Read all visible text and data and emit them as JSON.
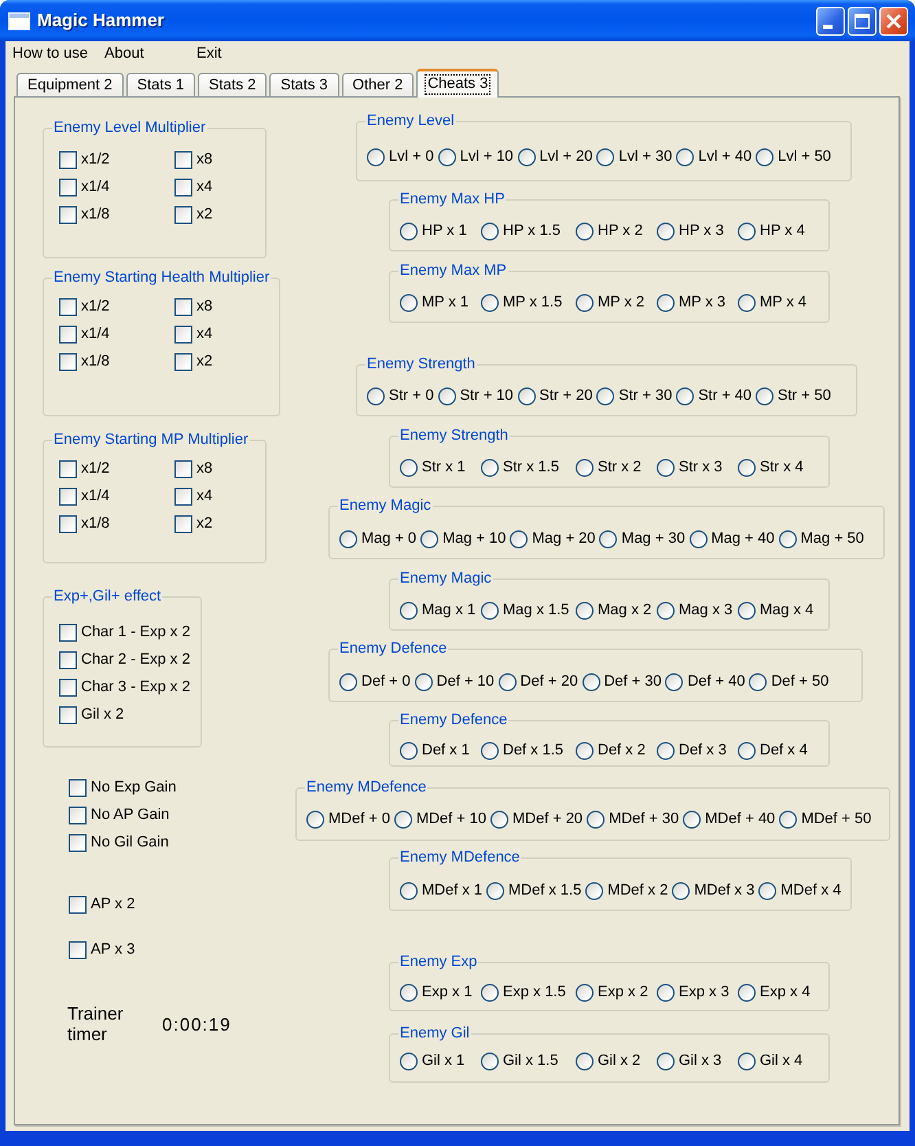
{
  "window": {
    "title": "Magic Hammer"
  },
  "menu": [
    "How to use",
    "About",
    "Exit"
  ],
  "tabs": [
    {
      "label": "Equipment 2",
      "selected": false
    },
    {
      "label": "Stats 1",
      "selected": false
    },
    {
      "label": "Stats 2",
      "selected": false
    },
    {
      "label": "Stats 3",
      "selected": false
    },
    {
      "label": "Other 2",
      "selected": false
    },
    {
      "label": "Cheats 3",
      "selected": true
    }
  ],
  "checkbox_groups": [
    {
      "title": "Enemy Level Multiplier",
      "options": [
        {
          "label": "x1/2",
          "checked": false
        },
        {
          "label": "x8",
          "checked": false
        },
        {
          "label": "x1/4",
          "checked": false
        },
        {
          "label": "x4",
          "checked": false
        },
        {
          "label": "x1/8",
          "checked": false
        },
        {
          "label": "x2",
          "checked": false
        }
      ]
    },
    {
      "title": "Enemy Starting Health Multiplier",
      "options": [
        {
          "label": "x1/2",
          "checked": false
        },
        {
          "label": "x8",
          "checked": false
        },
        {
          "label": "x1/4",
          "checked": false
        },
        {
          "label": "x4",
          "checked": false
        },
        {
          "label": "x1/8",
          "checked": false
        },
        {
          "label": "x2",
          "checked": false
        }
      ]
    },
    {
      "title": "Enemy Starting MP Multiplier",
      "options": [
        {
          "label": "x1/2",
          "checked": false
        },
        {
          "label": "x8",
          "checked": false
        },
        {
          "label": "x1/4",
          "checked": false
        },
        {
          "label": "x4",
          "checked": false
        },
        {
          "label": "x1/8",
          "checked": false
        },
        {
          "label": "x2",
          "checked": false
        }
      ]
    },
    {
      "title": "Exp+,Gil+ effect",
      "options": [
        {
          "label": "Char 1 - Exp x 2",
          "checked": false
        },
        {
          "label": "Char 2 - Exp x 2",
          "checked": false
        },
        {
          "label": "Char 3 - Exp x 2",
          "checked": false
        },
        {
          "label": "Gil x 2",
          "checked": false
        }
      ]
    }
  ],
  "toggles": [
    {
      "label": "No Exp Gain",
      "checked": false
    },
    {
      "label": "No AP Gain",
      "checked": false
    },
    {
      "label": "No Gil Gain",
      "checked": false
    },
    {
      "label": "AP x 2",
      "checked": false
    },
    {
      "label": "AP x 3",
      "checked": false
    }
  ],
  "trainer_timer": {
    "label": "Trainer timer",
    "value": "0:00:19"
  },
  "radio_groups": [
    {
      "title": "Enemy Level",
      "options": [
        {
          "label": "Lvl + 0",
          "selected": false
        },
        {
          "label": "Lvl + 10",
          "selected": false
        },
        {
          "label": "Lvl + 20",
          "selected": false
        },
        {
          "label": "Lvl + 30",
          "selected": false
        },
        {
          "label": "Lvl + 40",
          "selected": false
        },
        {
          "label": "Lvl + 50",
          "selected": false
        }
      ]
    },
    {
      "title": "Enemy Max HP",
      "options": [
        {
          "label": "HP x 1",
          "selected": false
        },
        {
          "label": "HP x 1.5",
          "selected": false
        },
        {
          "label": "HP x 2",
          "selected": false
        },
        {
          "label": "HP x 3",
          "selected": false
        },
        {
          "label": "HP x 4",
          "selected": false
        }
      ]
    },
    {
      "title": "Enemy Max MP",
      "options": [
        {
          "label": "MP x 1",
          "selected": false
        },
        {
          "label": "MP x 1.5",
          "selected": false
        },
        {
          "label": "MP x 2",
          "selected": false
        },
        {
          "label": "MP x 3",
          "selected": false
        },
        {
          "label": "MP x 4",
          "selected": false
        }
      ]
    },
    {
      "title": "Enemy Strength",
      "options": [
        {
          "label": "Str + 0",
          "selected": false
        },
        {
          "label": "Str + 10",
          "selected": false
        },
        {
          "label": "Str + 20",
          "selected": false
        },
        {
          "label": "Str + 30",
          "selected": false
        },
        {
          "label": "Str + 40",
          "selected": false
        },
        {
          "label": "Str + 50",
          "selected": false
        }
      ]
    },
    {
      "title": "Enemy Strength",
      "options": [
        {
          "label": "Str x 1",
          "selected": false
        },
        {
          "label": "Str x 1.5",
          "selected": false
        },
        {
          "label": "Str x 2",
          "selected": false
        },
        {
          "label": "Str x 3",
          "selected": false
        },
        {
          "label": "Str x 4",
          "selected": false
        }
      ]
    },
    {
      "title": "Enemy Magic",
      "options": [
        {
          "label": "Mag + 0",
          "selected": false
        },
        {
          "label": "Mag + 10",
          "selected": false
        },
        {
          "label": "Mag + 20",
          "selected": false
        },
        {
          "label": "Mag + 30",
          "selected": false
        },
        {
          "label": "Mag + 40",
          "selected": false
        },
        {
          "label": "Mag + 50",
          "selected": false
        }
      ]
    },
    {
      "title": "Enemy Magic",
      "options": [
        {
          "label": "Mag x 1",
          "selected": false
        },
        {
          "label": "Mag x 1.5",
          "selected": false
        },
        {
          "label": "Mag x 2",
          "selected": false
        },
        {
          "label": "Mag x 3",
          "selected": false
        },
        {
          "label": "Mag x 4",
          "selected": false
        }
      ]
    },
    {
      "title": "Enemy Defence",
      "options": [
        {
          "label": "Def + 0",
          "selected": false
        },
        {
          "label": "Def + 10",
          "selected": false
        },
        {
          "label": "Def + 20",
          "selected": false
        },
        {
          "label": "Def + 30",
          "selected": false
        },
        {
          "label": "Def + 40",
          "selected": false
        },
        {
          "label": "Def + 50",
          "selected": false
        }
      ]
    },
    {
      "title": "Enemy Defence",
      "options": [
        {
          "label": "Def x 1",
          "selected": false
        },
        {
          "label": "Def x 1.5",
          "selected": false
        },
        {
          "label": "Def x 2",
          "selected": false
        },
        {
          "label": "Def x 3",
          "selected": false
        },
        {
          "label": "Def x 4",
          "selected": false
        }
      ]
    },
    {
      "title": "Enemy MDefence",
      "options": [
        {
          "label": "MDef + 0",
          "selected": false
        },
        {
          "label": "MDef + 10",
          "selected": false
        },
        {
          "label": "MDef + 20",
          "selected": false
        },
        {
          "label": "MDef + 30",
          "selected": false
        },
        {
          "label": "MDef + 40",
          "selected": false
        },
        {
          "label": "MDef + 50",
          "selected": false
        }
      ]
    },
    {
      "title": "Enemy MDefence",
      "options": [
        {
          "label": "MDef x 1",
          "selected": false
        },
        {
          "label": "MDef x 1.5",
          "selected": false
        },
        {
          "label": "MDef x 2",
          "selected": false
        },
        {
          "label": "MDef x 3",
          "selected": false
        },
        {
          "label": "MDef x 4",
          "selected": false
        }
      ]
    },
    {
      "title": "Enemy Exp",
      "options": [
        {
          "label": "Exp x 1",
          "selected": false
        },
        {
          "label": "Exp x 1.5",
          "selected": false
        },
        {
          "label": "Exp x 2",
          "selected": false
        },
        {
          "label": "Exp x 3",
          "selected": false
        },
        {
          "label": "Exp x 4",
          "selected": false
        }
      ]
    },
    {
      "title": "Enemy Gil",
      "options": [
        {
          "label": "Gil x 1",
          "selected": false
        },
        {
          "label": "Gil x 1.5",
          "selected": false
        },
        {
          "label": "Gil x 2",
          "selected": false
        },
        {
          "label": "Gil x 3",
          "selected": false
        },
        {
          "label": "Gil x 4",
          "selected": false
        }
      ]
    }
  ]
}
